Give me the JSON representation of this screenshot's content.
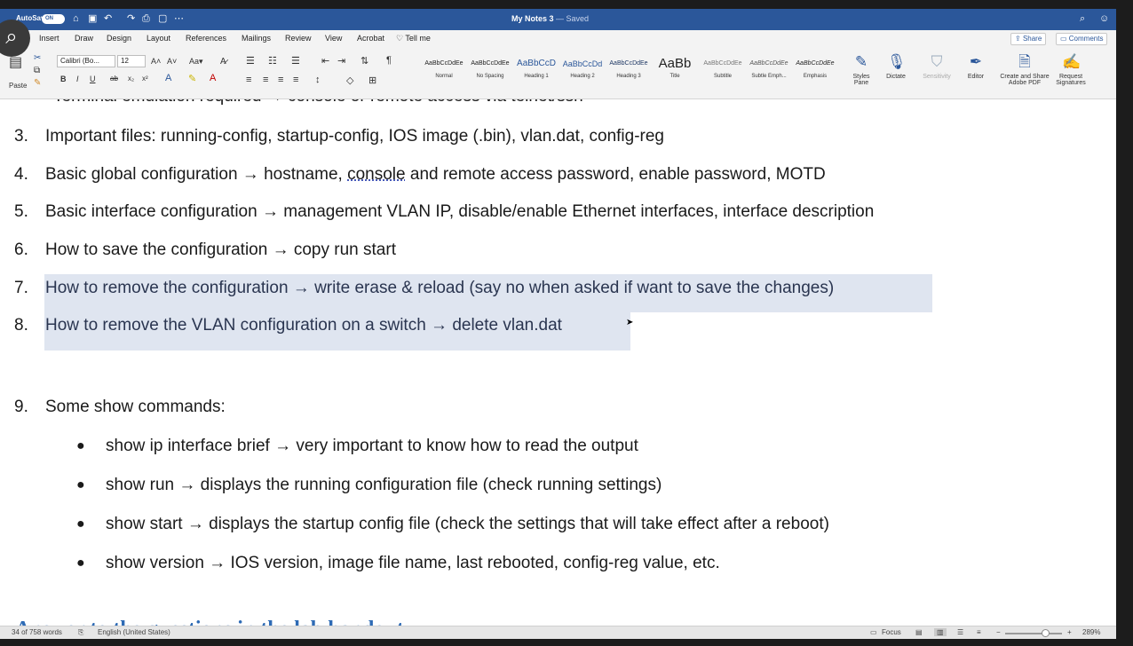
{
  "titlebar": {
    "autosave_label": "AutoSave",
    "autosave_state": "ON",
    "doc_title": "My Notes 3",
    "saved_status": "— Saved",
    "qat_icons": [
      "home-icon",
      "save-icon",
      "undo-icon",
      "redo-icon",
      "print-icon",
      "new-doc-icon",
      "more-icon"
    ]
  },
  "tabs": [
    "Insert",
    "Draw",
    "Design",
    "Layout",
    "References",
    "Mailings",
    "Review",
    "View",
    "Acrobat"
  ],
  "tell_me": "Tell me",
  "share_label": "Share",
  "comments_label": "Comments",
  "ribbon": {
    "paste_label": "Paste",
    "font_name": "Calibri (Bo...",
    "font_size": "12",
    "styles": [
      {
        "sample": "AaBbCcDdEe",
        "name": "Normal"
      },
      {
        "sample": "AaBbCcDdEe",
        "name": "No Spacing"
      },
      {
        "sample": "AaBbCcD",
        "name": "Heading 1"
      },
      {
        "sample": "AaBbCcDd",
        "name": "Heading 2"
      },
      {
        "sample": "AaBbCcDdEe",
        "name": "Heading 3"
      },
      {
        "sample": "AaBb",
        "name": "Title"
      },
      {
        "sample": "AaBbCcDdEe",
        "name": "Subtitle"
      },
      {
        "sample": "AaBbCcDdEe",
        "name": "Subtle Emph..."
      },
      {
        "sample": "AaBbCcDdEe",
        "name": "Emphasis"
      }
    ],
    "styles_pane": "Styles Pane",
    "dictate": "Dictate",
    "sensitivity": "Sensitivity",
    "editor": "Editor",
    "create_share": "Create and Share Adobe PDF",
    "request_sig": "Request Signatures"
  },
  "doc": {
    "cut_line": "Terminal emulation required → console or remote access via telnet/ssh",
    "items": [
      {
        "num": "3.",
        "text": "Important files: running-config, startup-config, IOS image (.bin), vlan.dat, config-reg"
      },
      {
        "num": "4.",
        "text_a": "Basic global configuration → hostname, ",
        "text_b": "console",
        "text_c": " and remote access password, enable password, MOTD"
      },
      {
        "num": "5.",
        "text": "Basic interface configuration → management VLAN IP, disable/enable Ethernet interfaces, interface description"
      },
      {
        "num": "6.",
        "text": "How to save the configuration → copy run start"
      },
      {
        "num": "7.",
        "text": "How to remove the configuration → write erase & reload (say no when asked if want to save the changes)"
      },
      {
        "num": "8.",
        "text": "How to remove the VLAN configuration on a switch → delete vlan.dat"
      },
      {
        "num": "9.",
        "text": "Some show commands:"
      }
    ],
    "bullets": [
      "show ip interface brief → very important to know how to read the output",
      "show run → displays the running configuration file (check running settings)",
      "show start → displays the startup config file (check the settings that will take effect after a reboot)",
      "show version → IOS version, image file name, last rebooted, config-reg value, etc."
    ],
    "heading": "Answer to the questions in the lab handout"
  },
  "status": {
    "words": "34 of 758 words",
    "language": "English (United States)",
    "focus": "Focus",
    "zoom": "289%"
  }
}
